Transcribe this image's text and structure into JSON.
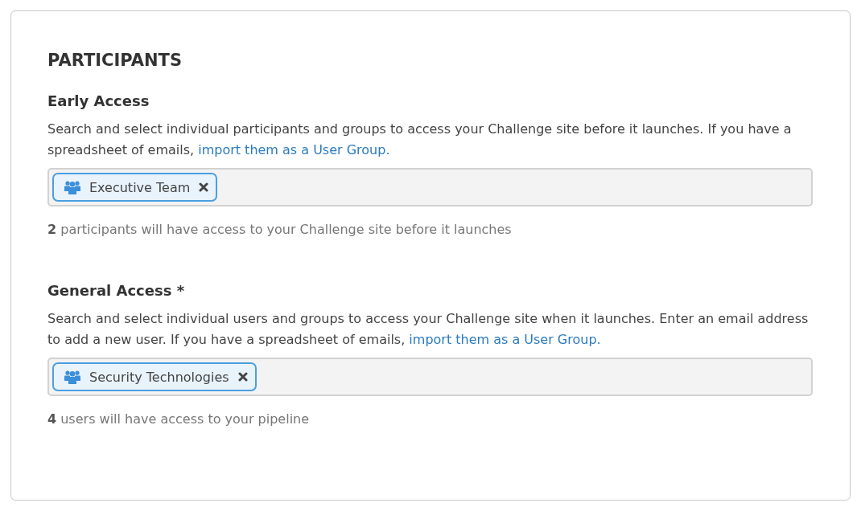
{
  "section": {
    "title": "PARTICIPANTS"
  },
  "groups": [
    {
      "heading": "Early Access",
      "description": "Search and select individual participants and groups to access your Challenge site before it launches. If you have a spreadsheet of emails, ",
      "link": "import them as a User Group.",
      "tags": [
        {
          "label": "Executive Team"
        }
      ],
      "summary": "**2** participants will have access to your Challenge site before it launches"
    },
    {
      "heading": "General Access *",
      "description": "Search and select individual users and groups to access your Challenge site when it launches. Enter an email address to add a new user. If you have a spreadsheet of emails, ",
      "link": "import them as a User Group.",
      "tags": [
        {
          "label": "Security Technologies"
        }
      ],
      "summary": "**4** users will have access to your pipeline"
    }
  ]
}
